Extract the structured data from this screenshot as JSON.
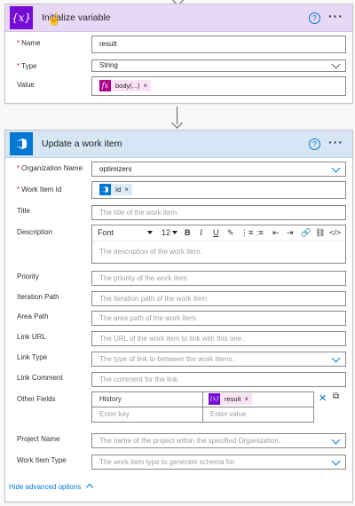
{
  "card1": {
    "title": "Initialize variable",
    "fields": {
      "name": {
        "label": "Name",
        "value": "result"
      },
      "type": {
        "label": "Type",
        "value": "String"
      },
      "value": {
        "label": "Value",
        "token": "body(...)"
      }
    }
  },
  "card2": {
    "title": "Update a work item",
    "fields": {
      "org": {
        "label": "Organization Name",
        "value": "optimizers"
      },
      "workitem": {
        "label": "Work Item Id",
        "token": "Id"
      },
      "title": {
        "label": "Title",
        "placeholder": "The title of the work item."
      },
      "description": {
        "label": "Description",
        "placeholder": "The description of the work item.",
        "font": "Font",
        "size": "12"
      },
      "priority": {
        "label": "Priority",
        "placeholder": "The priority of the work item."
      },
      "iteration": {
        "label": "Iteration Path",
        "placeholder": "The iteration path of the work item."
      },
      "area": {
        "label": "Area Path",
        "placeholder": "The area path of the work item."
      },
      "linkurl": {
        "label": "Link URL",
        "placeholder": "The URL of the work item to link with this one."
      },
      "linktype": {
        "label": "Link Type",
        "placeholder": "The type of link to between the work items."
      },
      "linkcomment": {
        "label": "Link Comment",
        "placeholder": "The comment for the link."
      },
      "otherfields": {
        "label": "Other Fields",
        "key": "History",
        "value_token": "result",
        "key_placeholder": "Enter key",
        "value_placeholder": "Enter value"
      },
      "project": {
        "label": "Project Name",
        "placeholder": "The name of the project within the specified Organization."
      },
      "witype": {
        "label": "Work Item Type",
        "placeholder": "The work item type to generate schema for."
      }
    },
    "advanced_link": "Hide advanced options"
  },
  "icons": {
    "variable": "{x}",
    "fx": "fx"
  }
}
